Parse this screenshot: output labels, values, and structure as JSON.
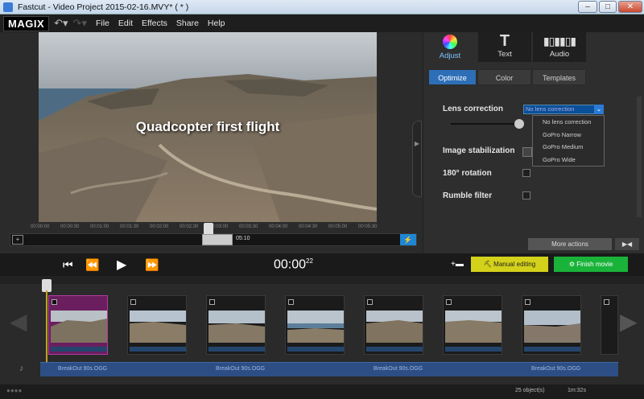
{
  "window": {
    "title": "Fastcut - Video Project 2015-02-16.MVY* ( * )",
    "controls": {
      "minimize": "–",
      "maximize": "□",
      "close": "✕"
    }
  },
  "menubar": {
    "logo": "MAGIX",
    "undo_icon": "undo-icon",
    "redo_icon": "redo-icon",
    "items": [
      "File",
      "Edit",
      "Effects",
      "Share",
      "Help"
    ]
  },
  "preview": {
    "overlay_title": "Quadcopter first flight"
  },
  "timeline": {
    "ticks": [
      "00:00:00",
      "00:00:30",
      "00:01:00",
      "00:01:30",
      "00:02:00",
      "00:02:30",
      "00:03:00",
      "00:03:30",
      "00:04:00",
      "00:04:30",
      "00:05:00",
      "00:05:30"
    ],
    "position_label": "05:10"
  },
  "panel": {
    "tabs": [
      {
        "label": "Adjust",
        "icon": "color-wheel-icon"
      },
      {
        "label": "Text",
        "icon": "text-T-icon"
      },
      {
        "label": "Audio",
        "icon": "audio-wave-icon"
      }
    ],
    "subtabs": [
      "Optimize",
      "Color",
      "Templates"
    ],
    "settings": {
      "lens_correction": "Lens correction",
      "image_stabilization": "Image stabilization",
      "rotation": "180° rotation",
      "rumble": "Rumble filter"
    },
    "lens_dropdown": {
      "selected": "No lens correction",
      "options": [
        "No lens correction",
        "GoPro Narrow",
        "GoPro Medium",
        "GoPro Wide"
      ]
    },
    "more_actions": "More actions"
  },
  "transport": {
    "timecode_main": "00:00",
    "timecode_frames": "22",
    "manual_editing": "Manual editing",
    "finish_movie": "Finish movie"
  },
  "audio": {
    "clip_labels": [
      "BreakOut 90s.OGG",
      "BreakOut 90s.OGG",
      "BreakOut 90s.OGG",
      "BreakOut 90s.OGG"
    ]
  },
  "status": {
    "objects": "25 object(s)",
    "duration": "1m:32s"
  },
  "colors": {
    "accent_blue": "#2d6fb7",
    "manual_yellow": "#d4d11a",
    "finish_green": "#1ab33a",
    "selected_clip": "#6a1e5e"
  }
}
